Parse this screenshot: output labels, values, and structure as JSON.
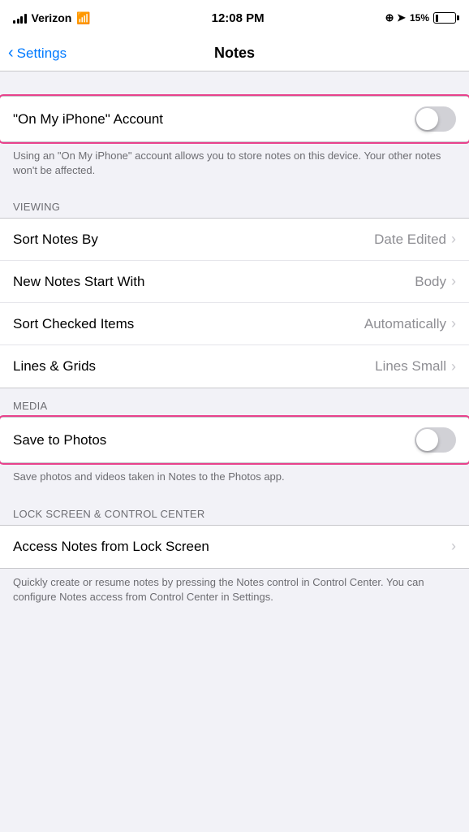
{
  "statusBar": {
    "carrier": "Verizon",
    "time": "12:08 PM",
    "batteryPct": "15%",
    "locationIcon": "⊕"
  },
  "navBar": {
    "backLabel": "Settings",
    "title": "Notes"
  },
  "sections": {
    "onMyIphone": {
      "label": "\"On My iPhone\" Account",
      "toggleOn": false,
      "description": "Using an \"On My iPhone\" account allows you to store notes on this device. Your other notes won't be affected."
    },
    "viewing": {
      "header": "VIEWING",
      "rows": [
        {
          "label": "Sort Notes By",
          "value": "Date Edited"
        },
        {
          "label": "New Notes Start With",
          "value": "Body"
        },
        {
          "label": "Sort Checked Items",
          "value": "Automatically"
        },
        {
          "label": "Lines & Grids",
          "value": "Lines Small"
        }
      ]
    },
    "media": {
      "header": "MEDIA",
      "saveToPhotos": {
        "label": "Save to Photos",
        "toggleOn": false,
        "description": "Save photos and videos taken in Notes to the Photos app."
      }
    },
    "lockScreen": {
      "header": "LOCK SCREEN & CONTROL CENTER",
      "rows": [
        {
          "label": "Access Notes from Lock Screen",
          "value": ""
        }
      ],
      "description": "Quickly create or resume notes by pressing the Notes control in Control Center. You can configure Notes access from Control Center in Settings."
    }
  }
}
